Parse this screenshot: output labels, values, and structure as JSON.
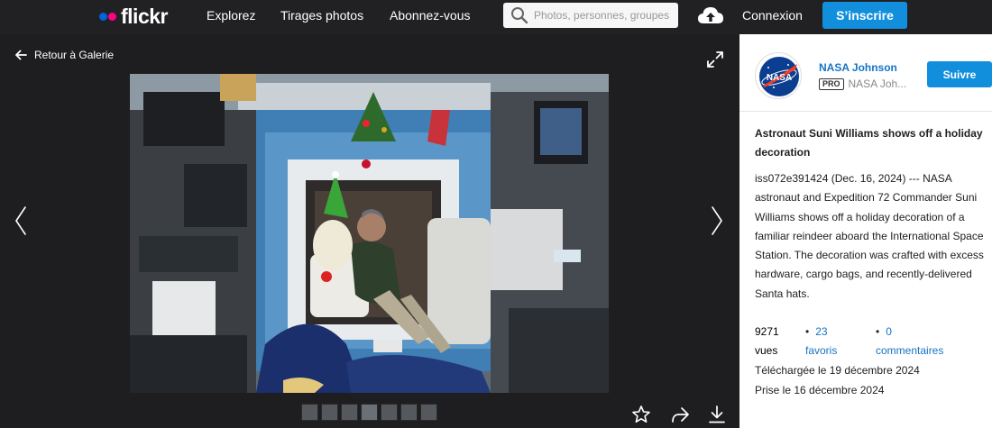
{
  "nav": {
    "logo": "flickr",
    "links": [
      "Explorez",
      "Tirages photos",
      "Abonnez-vous"
    ],
    "search_placeholder": "Photos, personnes, groupes",
    "login": "Connexion",
    "signup": "S’inscrire"
  },
  "colors": {
    "accent": "#128fdc",
    "link": "#1774c5",
    "topbar": "#212124",
    "logo_blue": "#0063dc",
    "logo_pink": "#ff0084"
  },
  "photo": {
    "back_label": "Retour à Galerie",
    "thumbnail_count": 7
  },
  "owner": {
    "name": "NASA Johnson",
    "badge": "PRO",
    "handle": "NASA Joh...",
    "follow_label": "Suivre",
    "avatar_text": "NASA"
  },
  "details": {
    "title": "Astronaut Suni Williams shows off a holiday decoration",
    "description": "iss072e391424 (Dec. 16, 2024) --- NASA astronaut and Expedition 72 Commander Suni Williams shows off a holiday decoration of a familiar reindeer aboard the International Space Station. The decoration was crafted with excess hardware, cargo bags, and recently-delivered Santa hats.",
    "views_count": "9271",
    "views_label": "vues",
    "faves_count": "23",
    "faves_label": "favoris",
    "comments_count": "0",
    "comments_label": "commentaires",
    "uploaded": "Téléchargée le 19 décembre 2024",
    "taken": "Prise le 16 décembre 2024"
  }
}
